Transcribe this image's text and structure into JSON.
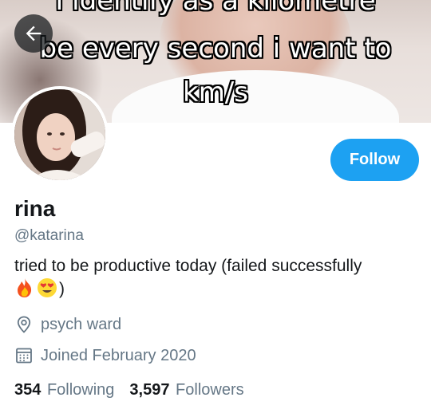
{
  "banner": {
    "meme_lines": [
      "I identify as a kilometre",
      "be every second i want to",
      "km/s"
    ]
  },
  "nav": {
    "back_icon": "arrow-left-icon"
  },
  "profile": {
    "display_name": "rina",
    "handle": "@katarina",
    "bio_text": "tried to be productive today (failed successfully",
    "bio_close": ")",
    "bio_emoji": [
      "fire-emoji",
      "heart-eyes-emoji"
    ],
    "location": "psych ward",
    "joined": "Joined February 2020"
  },
  "follow_button": {
    "label": "Follow"
  },
  "stats": {
    "following_count": "354",
    "following_label": "Following",
    "followers_count": "3,597",
    "followers_label": "Followers"
  },
  "colors": {
    "accent": "#1da1f2",
    "text_primary": "#14171a",
    "text_secondary": "#657786"
  }
}
